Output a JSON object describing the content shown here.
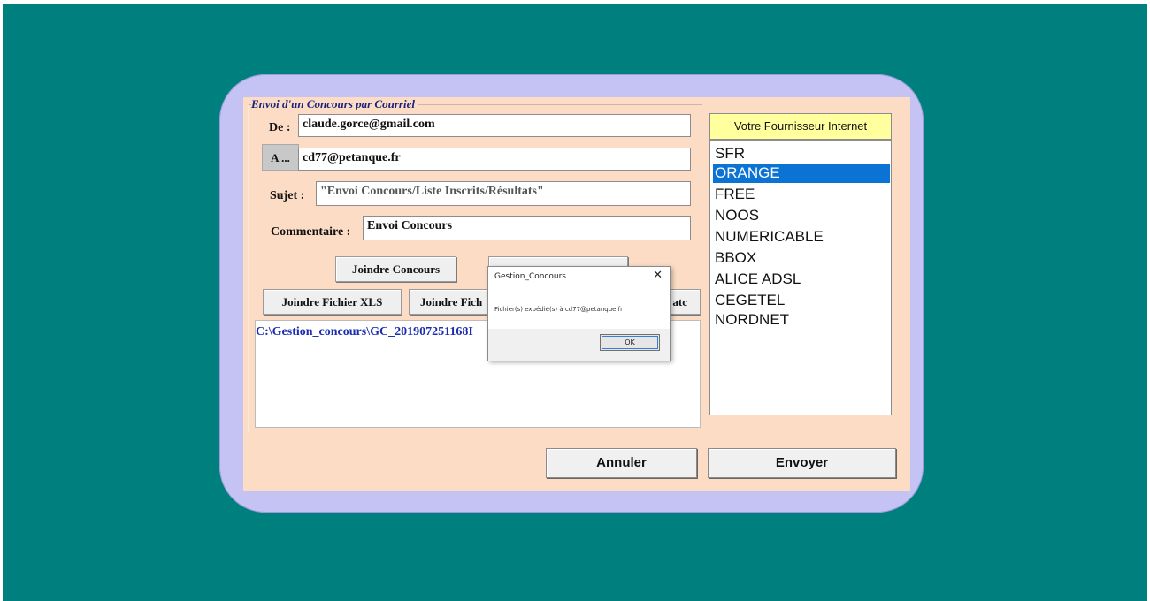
{
  "form": {
    "group_title": "Envoi d'un Concours par Courriel",
    "de_label": "De :",
    "de_value": "claude.gorce@gmail.com",
    "a_label": "A ...",
    "a_value": "cd77@petanque.fr",
    "sujet_label": "Sujet :",
    "sujet_value": "\"Envoi Concours/Liste Inscrits/Résultats\"",
    "commentaire_label": "Commentaire :",
    "commentaire_value": "Envoi Concours",
    "joindre_concours": "Joindre Concours",
    "joindre_fichier_xls": "Joindre Fichier XLS",
    "joindre_fichier_partial": "Joindre Fich",
    "joindre_partial_right": "atc",
    "attachment_path": "C:\\Gestion_concours\\GC_201907251168I"
  },
  "provider": {
    "header": "Votre Fournisseur Internet",
    "items": [
      "SFR",
      "ORANGE",
      "FREE",
      "NOOS",
      "NUMERICABLE",
      "BBOX",
      "ALICE ADSL",
      "CEGETEL",
      "NORDNET"
    ],
    "selected": "ORANGE"
  },
  "actions": {
    "annuler": "Annuler",
    "envoyer": "Envoyer"
  },
  "dialog": {
    "title": "Gestion_Concours",
    "close": "✕",
    "message": "Fichier(s) expédié(s) à cd77@petanque.fr",
    "ok": "OK"
  },
  "colors": {
    "desktop": "#007f7f",
    "frame": "#c4c3f3",
    "form_bg": "#fcdcc4",
    "selection": "#0b73d4",
    "header_yellow": "#ffff9d"
  }
}
